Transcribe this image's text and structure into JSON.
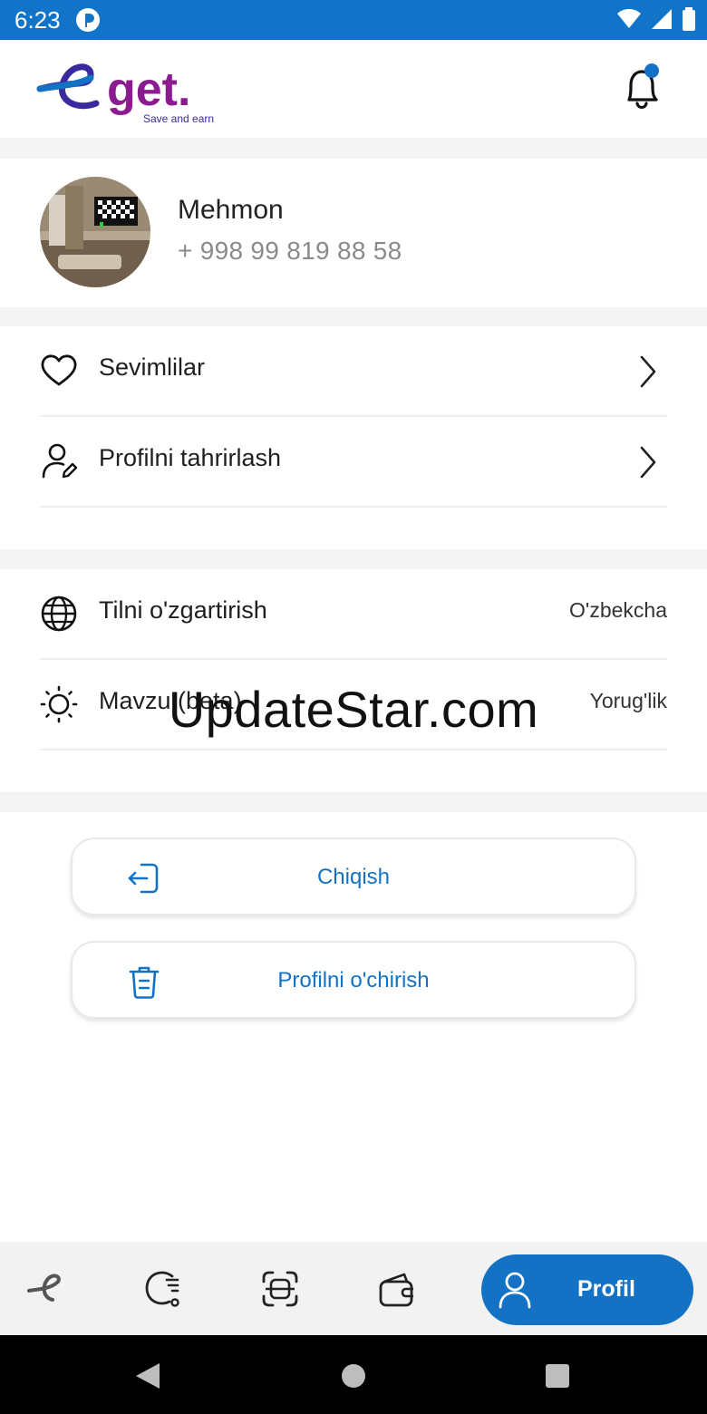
{
  "status_bar": {
    "time": "6:23"
  },
  "header": {
    "logo_text": "get.",
    "logo_tagline": "Save and earn",
    "notification_dot_color": "#1372c4"
  },
  "profile": {
    "name": "Mehmon",
    "phone": "+ 998 99 819 88 58"
  },
  "menu": {
    "favorites_label": "Sevimlilar",
    "edit_profile_label": "Profilni tahrirlash"
  },
  "settings": {
    "language_label": "Tilni o'zgartirish",
    "language_value": "O'zbekcha",
    "theme_label": "Mavzu (beta)",
    "theme_value": "Yorug'lik"
  },
  "watermark": "UpdateStar.com",
  "actions": {
    "logout_label": "Chiqish",
    "delete_label": "Profilni o'chirish"
  },
  "bottom_nav": {
    "active_label": "Profil",
    "accent_color": "#1372c4"
  }
}
